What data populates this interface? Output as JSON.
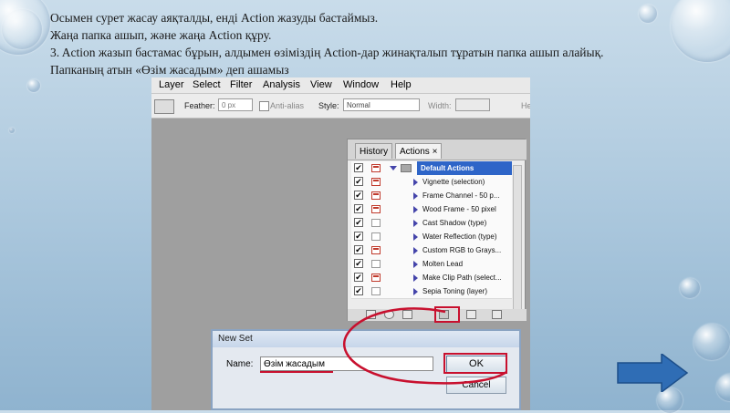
{
  "caption": {
    "line1": "Осымен сурет жасау аяқталды, енді Action жазуды бастаймыз.",
    "line2": "Жаңа папка ашып, және жаңа Action құру.",
    "line3": "3. Action жазып бастамас бұрын, алдымен өзіміздің Action-дар жинақталып тұратын папка ашып алайық.",
    "line4": "Папканың атын «Өзім жасадым» деп ашамыз"
  },
  "menubar": {
    "items": [
      "Layer",
      "Select",
      "Filter",
      "Analysis",
      "View",
      "Window",
      "Help"
    ]
  },
  "options": {
    "feather_label": "Feather:",
    "feather_value": "0 px",
    "antialias_label": "Anti-alias",
    "style_label": "Style:",
    "style_value": "Normal",
    "width_label": "Width:",
    "height_label": "He"
  },
  "panel": {
    "tab_history": "History",
    "tab_actions": "Actions ×",
    "set_name": "Default Actions",
    "actions": [
      "Vignette (selection)",
      "Frame Channel - 50 p...",
      "Wood Frame - 50 pixel",
      "Cast Shadow (type)",
      "Water Reflection (type)",
      "Custom RGB to Grays...",
      "Molten Lead",
      "Make Clip Path (select...",
      "Sepia Toning (layer)"
    ],
    "dialog_toggle_red": [
      true,
      true,
      true,
      false,
      false,
      true,
      false,
      true,
      false
    ]
  },
  "dialog": {
    "title": "New Set",
    "name_label": "Name:",
    "name_value": "Өзім жасадым",
    "ok_label": "OK",
    "cancel_label": "Cancel"
  },
  "colors": {
    "highlight": "#c8102e",
    "next_arrow": "#2f6db5"
  }
}
